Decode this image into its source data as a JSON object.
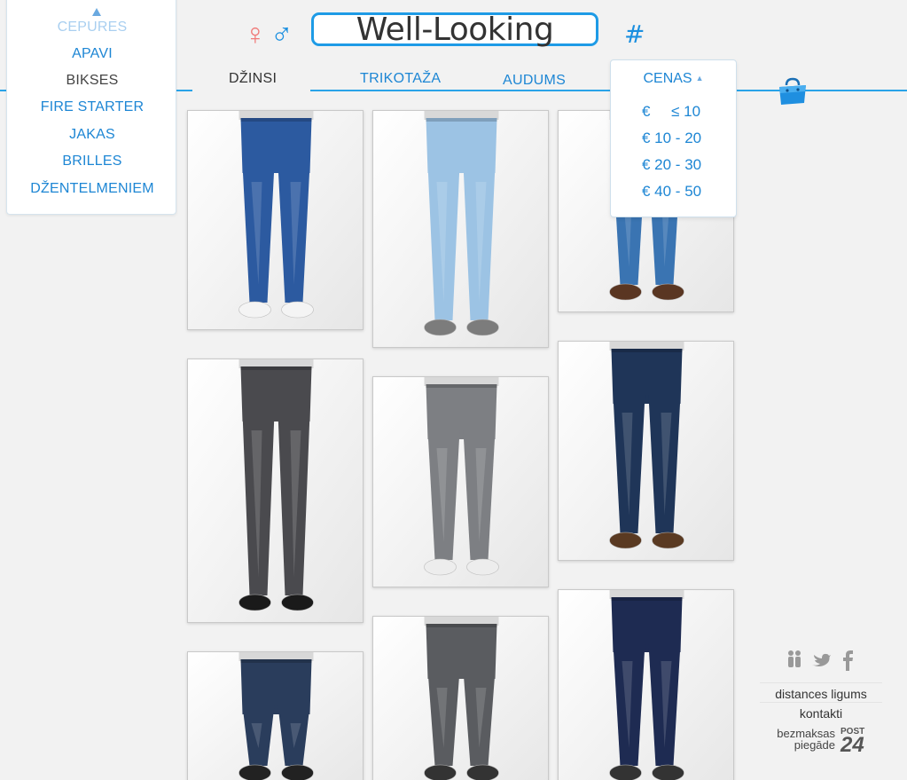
{
  "header": {
    "logo_text": "Well-Looking",
    "female_symbol": "♀",
    "male_symbol": "♂",
    "hash_symbol": "#"
  },
  "categories": {
    "items": [
      {
        "label": "CEPURES",
        "state": "faded"
      },
      {
        "label": "APAVI",
        "state": "normal"
      },
      {
        "label": "BIKSES",
        "state": "active"
      },
      {
        "label": "FIRE STARTER",
        "state": "normal"
      },
      {
        "label": "JAKAS",
        "state": "normal"
      },
      {
        "label": "BRILLES",
        "state": "normal"
      },
      {
        "label": "DŽENTELMENIEM",
        "state": "normal"
      }
    ]
  },
  "tabs": [
    {
      "label": "DŽINSI",
      "active": true
    },
    {
      "label": "TRIKOTAŽA",
      "active": false
    },
    {
      "label": "AUDUMS",
      "active": false
    }
  ],
  "price_filter": {
    "title": "CENAS",
    "options": [
      "€     ≤ 10",
      "€ 10 - 20",
      "€ 20 - 30",
      "€ 40 - 50"
    ]
  },
  "products": [
    {
      "color": "#2c5aa0",
      "shoe": "#f4f4f4"
    },
    {
      "color": "#9cc3e4",
      "shoe": "#7c7c7c"
    },
    {
      "color": "#3a74b2",
      "shoe": "#5a3622"
    },
    {
      "color": "#4a4a4e",
      "shoe": "#1a1a1a"
    },
    {
      "color": "#7d7f83",
      "shoe": "#ededed"
    },
    {
      "color": "#1f3558",
      "shoe": "#5a3a22"
    },
    {
      "color": "#2a3d5c",
      "shoe": "#222"
    },
    {
      "color": "#5a5c60",
      "shoe": "#333"
    },
    {
      "color": "#1e2b52",
      "shoe": "#333"
    }
  ],
  "footer": {
    "links": [
      "distances ligums",
      "kontakti"
    ],
    "shipping_line1": "bezmaksas",
    "shipping_line2": "piegāde",
    "post_label": "POST",
    "post_number": "24"
  },
  "colors": {
    "accent": "#1d86d4",
    "logo_border": "#1e9be6",
    "female": "#f07a78",
    "male": "#1a8fe0"
  }
}
